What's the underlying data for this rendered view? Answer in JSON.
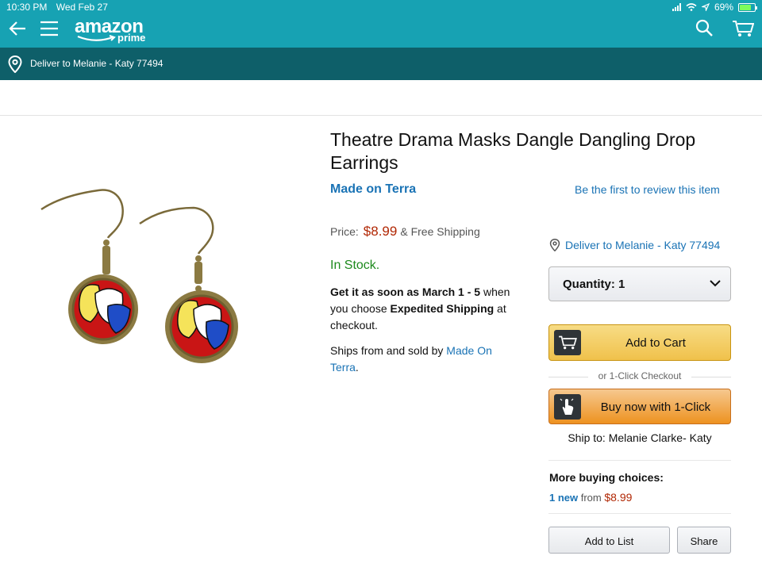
{
  "status_bar": {
    "time": "10:30 PM",
    "date": "Wed Feb 27",
    "battery": "69%"
  },
  "header": {
    "logo_text": "amazon",
    "logo_sub": "prime",
    "bg_color": "#17a2b3"
  },
  "deliver_bar": {
    "text": "Deliver to Melanie - Katy 77494",
    "bg_color": "#0e5f69"
  },
  "product": {
    "title": "Theatre Drama Masks Dangle Dangling Drop Earrings",
    "brand": "Made on Terra",
    "review_link": "Be the first to review this item",
    "price_label": "Price:",
    "price": "$8.99",
    "shipping": "& Free Shipping",
    "stock": "In Stock.",
    "delivery_prefix": "Get it as soon as March 1 - 5",
    "delivery_mid": " when you choose ",
    "delivery_bold": "Expedited Shipping",
    "delivery_suffix": " at checkout.",
    "ships_from_prefix": "Ships from and sold by ",
    "ships_from_link": "Made On Terra",
    "ships_from_suffix": "."
  },
  "buy_box": {
    "deliver_to": "Deliver to Melanie - Katy 77494",
    "quantity": "Quantity: 1",
    "add_to_cart": "Add to Cart",
    "one_click_label": "or 1-Click Checkout",
    "buy_now": "Buy now with 1-Click",
    "ship_to": "Ship to: Melanie Clarke- Katy",
    "more_buying_title": "More buying choices:",
    "more_new": "1 new",
    "more_from": " from ",
    "more_price": "$8.99",
    "add_to_list": "Add to List",
    "share": "Share"
  }
}
